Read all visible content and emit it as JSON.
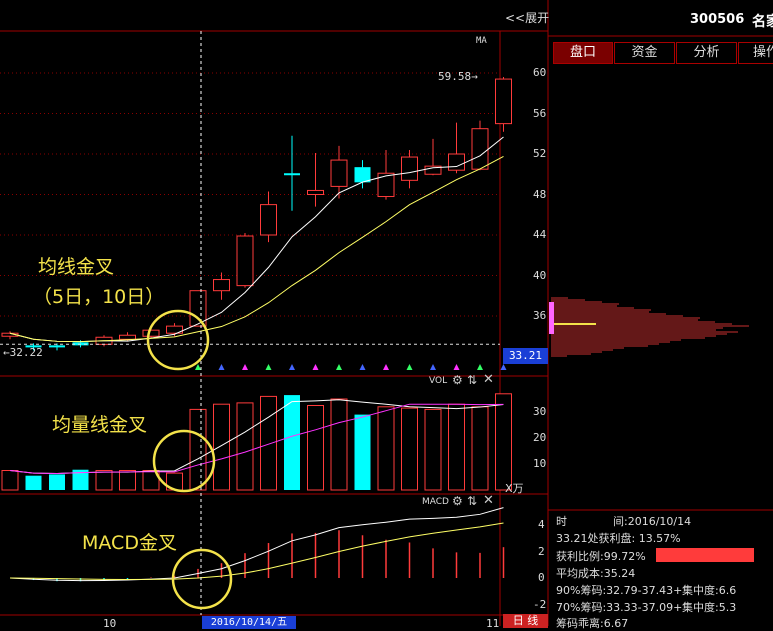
{
  "header": {
    "expand_label": "<<展开",
    "stock_code": "300506",
    "stock_name": "名家"
  },
  "tabs": [
    "盘口",
    "资金",
    "分析",
    "操作"
  ],
  "main_chart": {
    "indicator": "MA",
    "high_label": "59.58",
    "low_label": "32.22",
    "current_price": "33.21",
    "y_ticks": [
      "60",
      "56",
      "52",
      "48",
      "44",
      "40",
      "36"
    ],
    "candles": [
      {
        "o": 34.0,
        "c": 34.3,
        "h": 34.5,
        "l": 33.7,
        "color": "red"
      },
      {
        "o": 32.9,
        "c": 33.1,
        "h": 33.3,
        "l": 32.6,
        "color": "cyan"
      },
      {
        "o": 32.9,
        "c": 33.1,
        "h": 33.3,
        "l": 32.6,
        "color": "cyan"
      },
      {
        "o": 33.1,
        "c": 33.4,
        "h": 33.6,
        "l": 32.9,
        "color": "cyan"
      },
      {
        "o": 33.2,
        "c": 33.9,
        "h": 34.1,
        "l": 33.0,
        "color": "red"
      },
      {
        "o": 33.7,
        "c": 34.1,
        "h": 34.4,
        "l": 33.5,
        "color": "red"
      },
      {
        "o": 34.0,
        "c": 34.6,
        "h": 35.0,
        "l": 33.8,
        "color": "red"
      },
      {
        "o": 34.3,
        "c": 35.0,
        "h": 35.3,
        "l": 34.0,
        "color": "red"
      },
      {
        "o": 35.0,
        "c": 38.5,
        "h": 38.5,
        "l": 35.0,
        "color": "red"
      },
      {
        "o": 38.5,
        "c": 39.6,
        "h": 40.3,
        "l": 37.6,
        "color": "red"
      },
      {
        "o": 39.0,
        "c": 43.9,
        "h": 44.2,
        "l": 38.8,
        "color": "red"
      },
      {
        "o": 44.0,
        "c": 47.0,
        "h": 48.3,
        "l": 43.3,
        "color": "red"
      },
      {
        "o": 50.1,
        "c": 50.1,
        "h": 53.8,
        "l": 46.4,
        "color": "cyan"
      },
      {
        "o": 48.0,
        "c": 48.4,
        "h": 52.1,
        "l": 46.8,
        "color": "red"
      },
      {
        "o": 48.8,
        "c": 51.4,
        "h": 52.8,
        "l": 47.6,
        "color": "red"
      },
      {
        "o": 50.7,
        "c": 49.2,
        "h": 51.4,
        "l": 48.6,
        "color": "cyan"
      },
      {
        "o": 47.8,
        "c": 50.1,
        "h": 52.4,
        "l": 47.5,
        "color": "red"
      },
      {
        "o": 49.4,
        "c": 51.7,
        "h": 52.4,
        "l": 48.6,
        "color": "red"
      },
      {
        "o": 50.0,
        "c": 50.8,
        "h": 53.5,
        "l": 49.9,
        "color": "red"
      },
      {
        "o": 50.4,
        "c": 52.0,
        "h": 55.1,
        "l": 50.1,
        "color": "red"
      },
      {
        "o": 50.5,
        "c": 54.5,
        "h": 55.3,
        "l": 50.4,
        "color": "red"
      },
      {
        "o": 55.0,
        "c": 59.4,
        "h": 59.6,
        "l": 54.2,
        "color": "red"
      }
    ]
  },
  "volume_chart": {
    "title": "VOL",
    "unit": "X万",
    "y_ticks": [
      "30",
      "20",
      "10"
    ],
    "bars": [
      {
        "v": 7.5,
        "color": "red"
      },
      {
        "v": 5.5,
        "color": "cyan"
      },
      {
        "v": 6.0,
        "color": "cyan"
      },
      {
        "v": 7.8,
        "color": "cyan"
      },
      {
        "v": 7.5,
        "color": "red"
      },
      {
        "v": 7.5,
        "color": "red"
      },
      {
        "v": 7.5,
        "color": "red"
      },
      {
        "v": 6.5,
        "color": "red"
      },
      {
        "v": 31.0,
        "color": "red"
      },
      {
        "v": 33.0,
        "color": "red"
      },
      {
        "v": 33.5,
        "color": "red"
      },
      {
        "v": 36.0,
        "color": "red"
      },
      {
        "v": 36.5,
        "color": "cyan"
      },
      {
        "v": 32.5,
        "color": "red"
      },
      {
        "v": 35.0,
        "color": "red"
      },
      {
        "v": 29.0,
        "color": "cyan"
      },
      {
        "v": 32.0,
        "color": "red"
      },
      {
        "v": 31.5,
        "color": "red"
      },
      {
        "v": 31.0,
        "color": "red"
      },
      {
        "v": 33.0,
        "color": "red"
      },
      {
        "v": 32.0,
        "color": "red"
      },
      {
        "v": 37.0,
        "color": "red"
      }
    ]
  },
  "macd_chart": {
    "title": "MACD",
    "y_ticks": [
      "4",
      "2",
      "0",
      "-2"
    ]
  },
  "bottom_axis": {
    "left_label": "10",
    "cursor_date": "2016/10/14/五",
    "right_label": "11",
    "period_label": "日 线"
  },
  "annotations": {
    "ma_cross": "均线金叉",
    "ma_cross_sub": "（5日，10日）",
    "vol_cross": "均量线金叉",
    "macd_cross": "MACD金叉"
  },
  "info_panel": {
    "time_label": "时",
    "time_sep": "间:",
    "time_value": "2016/10/14",
    "profit_line": "33.21处获利盘: 13.57%",
    "profit_ratio": "获利比例:99.72%",
    "avg_cost": "平均成本:35.24",
    "chip90": "90%筹码:32.79-37.43+",
    "conc90": "集中度:6.6",
    "chip70": "70%筹码:33.33-37.09+",
    "conc70": "集中度:5.3",
    "deviation": "筹码乖离:6.67"
  },
  "colors": {
    "up": "#ff3b3b",
    "down": "#00ffff",
    "annotation": "#f3e24a",
    "ma5": "#ffffff",
    "ma10": "#ffff66",
    "vol_ma2": "#ff33ff",
    "tab_active": "#7a0000",
    "price_tag": "#1a3fd6"
  }
}
